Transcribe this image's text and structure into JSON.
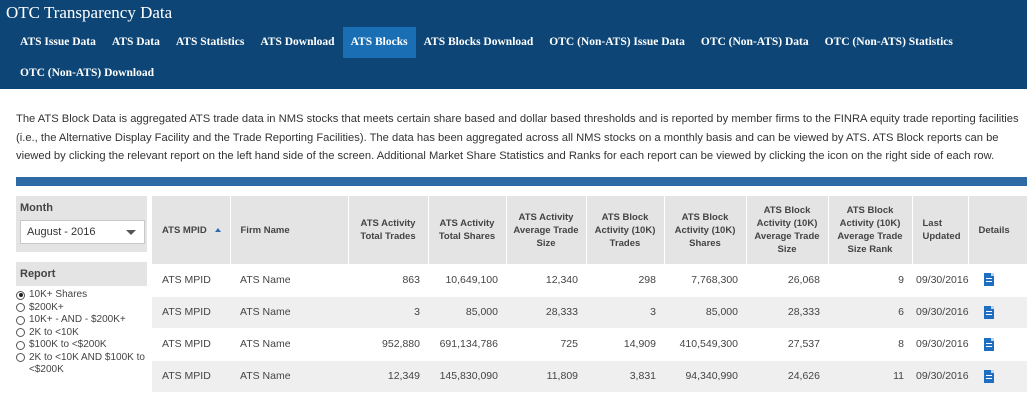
{
  "app": {
    "title": "OTC Transparency Data"
  },
  "nav": {
    "tabs": [
      {
        "label": "ATS Issue Data",
        "active": false
      },
      {
        "label": "ATS Data",
        "active": false
      },
      {
        "label": "ATS Statistics",
        "active": false
      },
      {
        "label": "ATS Download",
        "active": false
      },
      {
        "label": "ATS Blocks",
        "active": true
      },
      {
        "label": "ATS Blocks Download",
        "active": false
      },
      {
        "label": "OTC (Non-ATS) Issue Data",
        "active": false
      },
      {
        "label": "OTC (Non-ATS) Data",
        "active": false
      },
      {
        "label": "OTC (Non-ATS) Statistics",
        "active": false
      },
      {
        "label": "OTC (Non-ATS) Download",
        "active": false
      }
    ]
  },
  "intro": "The ATS Block Data is aggregated ATS trade data in NMS stocks that meets certain share based and dollar based thresholds and is reported by member firms to the FINRA equity trade reporting facilities (i.e., the Alternative Display Facility and the Trade Reporting Facilities). The data has been aggregated across all NMS stocks on a monthly basis and can be viewed by ATS. ATS Block reports can be viewed by clicking the relevant report on the left hand side of the screen. Additional Market Share Statistics and Ranks for each report can be viewed by clicking the icon on the right side of each row.",
  "filters": {
    "month_label": "Month",
    "month_value": "August - 2016",
    "report_label": "Report",
    "reports": [
      {
        "label": "10K+ Shares",
        "selected": true
      },
      {
        "label": "$200K+",
        "selected": false
      },
      {
        "label": "10K+ - AND - $200K+",
        "selected": false
      },
      {
        "label": "2K to <10K",
        "selected": false
      },
      {
        "label": "$100K to <$200K",
        "selected": false
      },
      {
        "label": "2K to <10K AND $100K to <$200K",
        "selected": false
      }
    ]
  },
  "table": {
    "columns": [
      "ATS MPID",
      "Firm Name",
      "ATS Activity Total Trades",
      "ATS Activity Total Shares",
      "ATS Activity Average Trade Size",
      "ATS Block Activity (10K) Trades",
      "ATS Block Activity (10K) Shares",
      "ATS Block Activity (10K) Average Trade Size",
      "ATS Block Activity (10K) Average Trade Size Rank",
      "Last Updated",
      "Details"
    ],
    "sort_icon": "sort-ascending-icon",
    "detail_icon": "document-icon",
    "rows": [
      [
        "ATS MPID",
        "ATS Name",
        "863",
        "10,649,100",
        "12,340",
        "298",
        "7,768,300",
        "26,068",
        "9",
        "09/30/2016"
      ],
      [
        "ATS MPID",
        "ATS Name",
        "3",
        "85,000",
        "28,333",
        "3",
        "85,000",
        "28,333",
        "6",
        "09/30/2016"
      ],
      [
        "ATS MPID",
        "ATS Name",
        "952,880",
        "691,134,786",
        "725",
        "14,909",
        "410,549,300",
        "27,537",
        "8",
        "09/30/2016"
      ],
      [
        "ATS MPID",
        "ATS Name",
        "12,349",
        "145,830,090",
        "11,809",
        "3,831",
        "94,340,990",
        "24,626",
        "11",
        "09/30/2016"
      ]
    ]
  },
  "colors": {
    "header_bg": "#0d4676",
    "active_tab": "#1a6fb4",
    "rule": "#2e6aa3",
    "icon": "#1e6fc1"
  }
}
